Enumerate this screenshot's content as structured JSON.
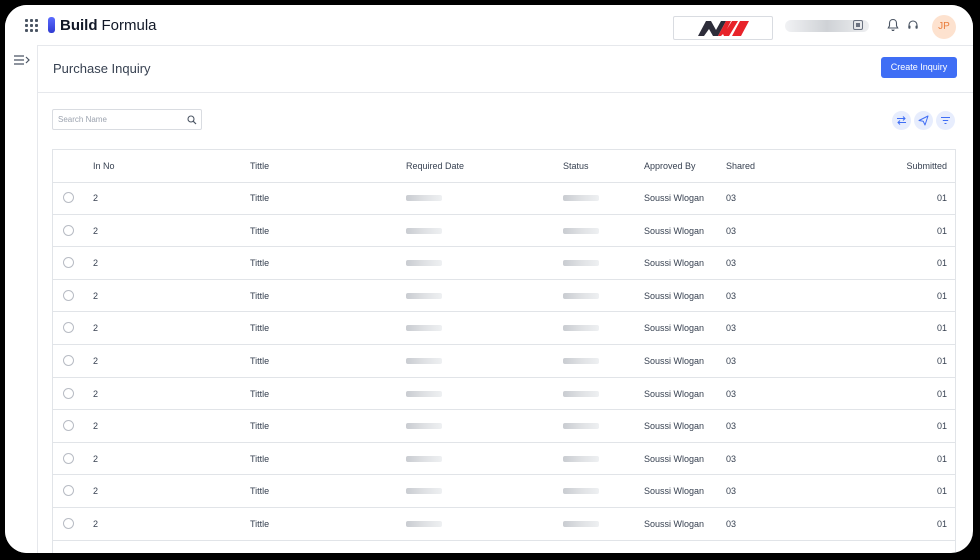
{
  "app": {
    "name_bold": "Build",
    "name_light": "Formula",
    "avatar_initials": "JP"
  },
  "colors": {
    "accent": "#3f6ef5",
    "brand_red": "#e8232a",
    "brand_dark": "#2d2d3a",
    "avatar_bg": "#fde2cf",
    "avatar_text": "#e97c3b"
  },
  "icons": {
    "apps": "grid-icon",
    "sidebar_toggle": "menu-collapse-icon",
    "notifications": "bell-icon",
    "support": "headset-icon",
    "search": "search-icon",
    "swap": "swap-icon",
    "send": "send-icon",
    "filter": "filter-icon"
  },
  "page": {
    "title": "Purchase Inquiry",
    "create_label": "Create Inquiry"
  },
  "search": {
    "placeholder": "Search Name"
  },
  "table": {
    "columns": [
      "In No",
      "Tittle",
      "Required Date",
      "Status",
      "Approved By",
      "Shared",
      "Submitted"
    ],
    "rows": [
      {
        "no": "2",
        "title": "Tittle",
        "approved_by": "Soussi Wlogan",
        "shared": "03",
        "submitted": "01"
      },
      {
        "no": "2",
        "title": "Tittle",
        "approved_by": "Soussi Wlogan",
        "shared": "03",
        "submitted": "01"
      },
      {
        "no": "2",
        "title": "Tittle",
        "approved_by": "Soussi Wlogan",
        "shared": "03",
        "submitted": "01"
      },
      {
        "no": "2",
        "title": "Tittle",
        "approved_by": "Soussi Wlogan",
        "shared": "03",
        "submitted": "01"
      },
      {
        "no": "2",
        "title": "Tittle",
        "approved_by": "Soussi Wlogan",
        "shared": "03",
        "submitted": "01"
      },
      {
        "no": "2",
        "title": "Tittle",
        "approved_by": "Soussi Wlogan",
        "shared": "03",
        "submitted": "01"
      },
      {
        "no": "2",
        "title": "Tittle",
        "approved_by": "Soussi Wlogan",
        "shared": "03",
        "submitted": "01"
      },
      {
        "no": "2",
        "title": "Tittle",
        "approved_by": "Soussi Wlogan",
        "shared": "03",
        "submitted": "01"
      },
      {
        "no": "2",
        "title": "Tittle",
        "approved_by": "Soussi Wlogan",
        "shared": "03",
        "submitted": "01"
      },
      {
        "no": "2",
        "title": "Tittle",
        "approved_by": "Soussi Wlogan",
        "shared": "03",
        "submitted": "01"
      },
      {
        "no": "2",
        "title": "Tittle",
        "approved_by": "Soussi Wlogan",
        "shared": "03",
        "submitted": "01"
      }
    ]
  }
}
